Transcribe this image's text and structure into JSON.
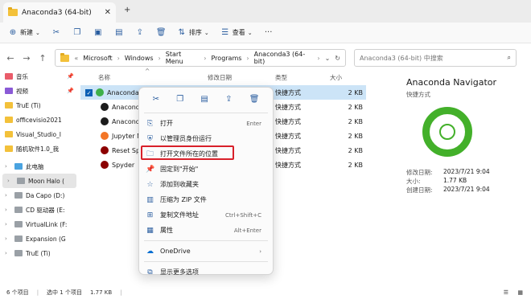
{
  "tab": {
    "title": "Anaconda3 (64-bit)"
  },
  "toolbar": {
    "new": "新建",
    "sort": "排序",
    "view": "查看"
  },
  "address": {
    "segments": [
      "Microsoft",
      "Windows",
      "Start Menu",
      "Programs",
      "Anaconda3 (64-bit)"
    ],
    "search_placeholder": "Anaconda3 (64-bit) 中搜索"
  },
  "nav": {
    "items": [
      {
        "label": "音乐",
        "color": "#e95c6a",
        "pin": true
      },
      {
        "label": "视频",
        "color": "#8a5ad6",
        "pin": true
      },
      {
        "label": "TruE (Ti)",
        "color": "#f3c13a"
      },
      {
        "label": "officevisio2021",
        "color": "#f3c13a"
      },
      {
        "label": "Visual_Studio_I",
        "color": "#f3c13a"
      },
      {
        "label": "随机软件1.0_我",
        "color": "#f3c13a"
      },
      {
        "label": "此电脑",
        "color": "#4aa3e0"
      },
      {
        "label": "Moon Halo (",
        "color": "#9aa0a6",
        "selected": true
      },
      {
        "label": "Da Capo (D:)",
        "color": "#9aa0a6"
      },
      {
        "label": "CD 驱动器 (E:",
        "color": "#9aa0a6"
      },
      {
        "label": "VirtualLink (F:",
        "color": "#9aa0a6"
      },
      {
        "label": "Expansion (G",
        "color": "#9aa0a6"
      },
      {
        "label": "TruE (Ti)",
        "color": "#9aa0a6"
      }
    ]
  },
  "columns": {
    "name": "名称",
    "modified": "修改日期",
    "type": "类型",
    "size": "大小"
  },
  "files": [
    {
      "name": "Anaconda Na",
      "type": "快捷方式",
      "size": "2 KB",
      "color": "#3eb049"
    },
    {
      "name": "Anaconda Po",
      "type": "快捷方式",
      "size": "2 KB",
      "color": "#1c1c1c"
    },
    {
      "name": "Anaconda Pro",
      "type": "快捷方式",
      "size": "2 KB",
      "color": "#1c1c1c"
    },
    {
      "name": "Jupyter Notel",
      "type": "快捷方式",
      "size": "2 KB",
      "color": "#f37626"
    },
    {
      "name": "Reset Spyder",
      "type": "快捷方式",
      "size": "2 KB",
      "color": "#8c0000"
    },
    {
      "name": "Spyder",
      "type": "快捷方式",
      "size": "2 KB",
      "color": "#8c0000"
    }
  ],
  "context_menu": {
    "items": [
      {
        "label": "打开",
        "shortcut": "Enter",
        "icon": "open-icon"
      },
      {
        "label": "以管理员身份运行",
        "shortcut": "",
        "icon": "shield-icon"
      },
      {
        "label": "打开文件所在的位置",
        "shortcut": "",
        "icon": "folder-icon",
        "highlighted": true
      },
      {
        "label": "固定到\"开始\"",
        "shortcut": "",
        "icon": "pin-icon"
      },
      {
        "label": "添加到收藏夹",
        "shortcut": "",
        "icon": "star-icon"
      },
      {
        "label": "压缩为 ZIP 文件",
        "shortcut": "",
        "icon": "zip-icon"
      },
      {
        "label": "复制文件地址",
        "shortcut": "Ctrl+Shift+C",
        "icon": "copy-path-icon"
      },
      {
        "label": "属性",
        "shortcut": "Alt+Enter",
        "icon": "properties-icon"
      }
    ],
    "onedrive": "OneDrive",
    "more": "显示更多选项"
  },
  "details": {
    "title": "Anaconda Navigator",
    "subtitle": "快捷方式",
    "props": [
      {
        "key": "修改日期:",
        "value": "2023/7/21 9:04"
      },
      {
        "key": "大小:",
        "value": "1.77 KB"
      },
      {
        "key": "创建日期:",
        "value": "2023/7/21 9:04"
      }
    ]
  },
  "status": {
    "count": "6 个项目",
    "selected": "选中 1 个项目",
    "size": "1.77 KB"
  }
}
